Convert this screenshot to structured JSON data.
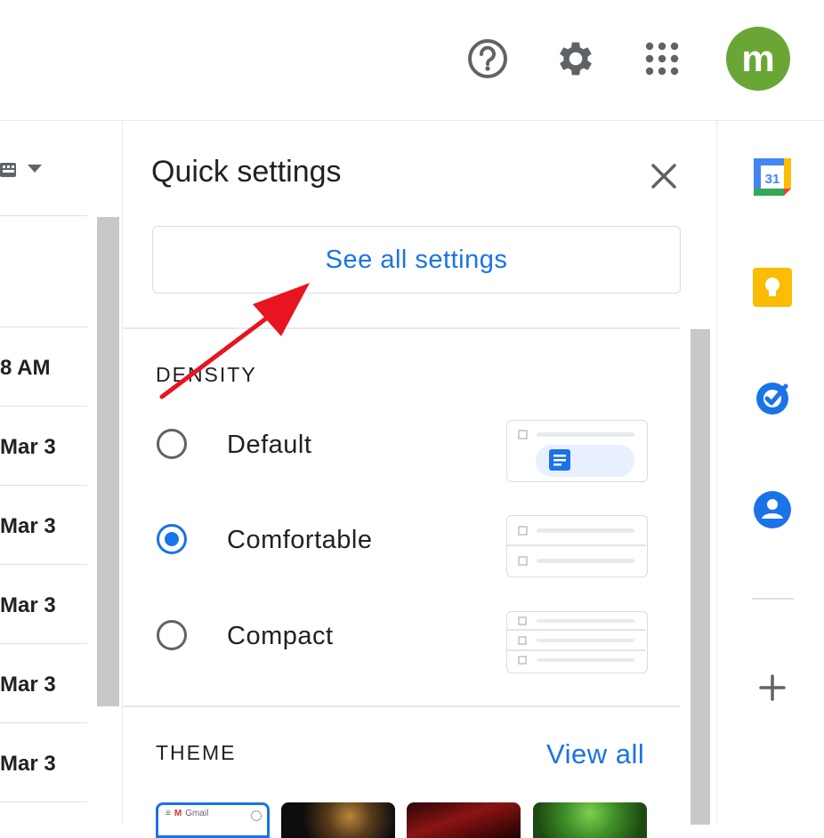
{
  "topbar": {
    "help_icon": "help-circle-icon",
    "settings_icon": "gear-icon",
    "apps_icon": "apps-grid-icon",
    "avatar_letter": "m",
    "avatar_color": "#6aa635"
  },
  "mail_list": {
    "dates": [
      "8 AM",
      "Mar 3",
      "Mar 3",
      "Mar 3",
      "Mar 3",
      "Mar 3"
    ]
  },
  "quick_settings": {
    "title": "Quick settings",
    "see_all_label": "See all settings",
    "density": {
      "label": "DENSITY",
      "options": [
        {
          "label": "Default",
          "selected": false
        },
        {
          "label": "Comfortable",
          "selected": true
        },
        {
          "label": "Compact",
          "selected": false
        }
      ]
    },
    "theme": {
      "label": "THEME",
      "view_all_label": "View all",
      "first_thumb_text": "Gmail"
    }
  },
  "side_apps": {
    "calendar_day": "31",
    "icons": [
      "calendar-icon",
      "keep-icon",
      "tasks-icon",
      "contacts-icon",
      "add-icon"
    ]
  },
  "colors": {
    "accent": "#1a73e8",
    "annotation_arrow": "#e8141f"
  }
}
